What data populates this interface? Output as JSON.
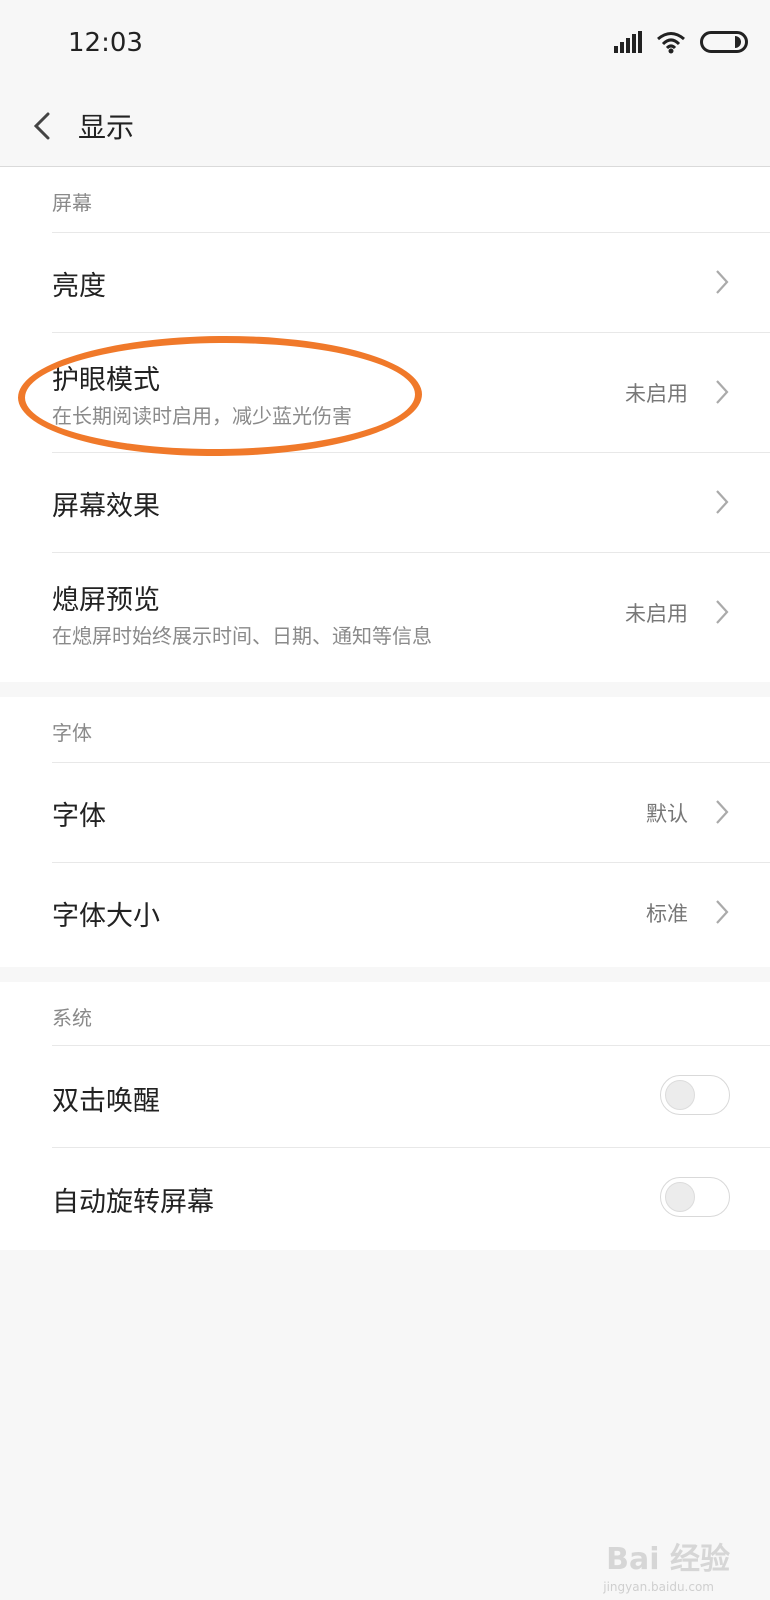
{
  "status": {
    "time": "12:03"
  },
  "header": {
    "title": "显示"
  },
  "sections": {
    "screen": {
      "label": "屏幕",
      "brightness": {
        "label": "亮度"
      },
      "eye_mode": {
        "label": "护眼模式",
        "sub": "在长期阅读时启用，减少蓝光伤害",
        "value": "未启用"
      },
      "screen_effect": {
        "label": "屏幕效果"
      },
      "aod": {
        "label": "熄屏预览",
        "sub": "在熄屏时始终展示时间、日期、通知等信息",
        "value": "未启用"
      }
    },
    "font": {
      "label": "字体",
      "font": {
        "label": "字体",
        "value": "默认"
      },
      "font_size": {
        "label": "字体大小",
        "value": "标准"
      }
    },
    "system": {
      "label": "系统",
      "double_tap": {
        "label": "双击唤醒",
        "enabled": false
      },
      "auto_rotate": {
        "label": "自动旋转屏幕",
        "enabled": false
      }
    }
  },
  "annotation": {
    "color": "#f0792a",
    "highlight": "eye_mode"
  },
  "watermark": {
    "text": "Bai 经验",
    "sub": "jingyan.baidu.com"
  }
}
